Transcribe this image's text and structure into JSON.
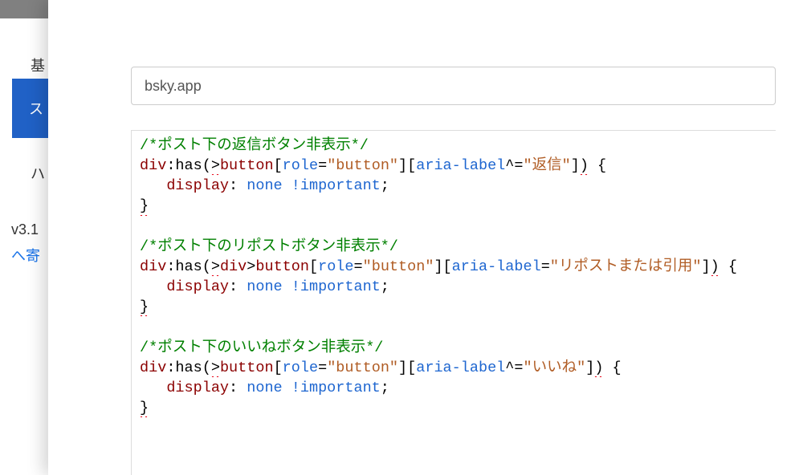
{
  "bg": {
    "heading_glimpse": "基",
    "blue_btn_glimpse": "ス",
    "note_glimpse": "ハ",
    "version": "v3.1",
    "donate": "へ寄"
  },
  "modal": {
    "url_value": "bsky.app"
  },
  "css": {
    "c1": "/*ポスト下の返信ボタン非表示*/",
    "c2": "/*ポスト下のリポストボタン非表示*/",
    "c3": "/*ポスト下のいいねボタン非表示*/",
    "sel1_a": "div",
    "sel1_b": ":has(",
    "sel1_c": "button",
    "sel1_d": "[",
    "sel1_e": "role",
    "sel1_f": "=",
    "sel1_g": "\"button\"",
    "sel1_h": "][",
    "sel1_i": "aria-label",
    "sel1_j": "^=",
    "sel1_k": "\"返信\"",
    "sel1_l": "]",
    "sel1_m": ") {",
    "sel1_gt": ">",
    "decl_prop": "display",
    "decl_colon": ": ",
    "decl_val": "none !important",
    "decl_semi": ";",
    "brace_close": "}",
    "sel2_a": "div",
    "sel2_b": ":has(",
    "sel2_c": "div",
    "sel2_d": ">",
    "sel2_e": "button",
    "sel2_f": "[",
    "sel2_g": "role",
    "sel2_h": "=",
    "sel2_i": "\"button\"",
    "sel2_j": "][",
    "sel2_k": "aria-label",
    "sel2_l": "=",
    "sel2_m": "\"リポストまたは引用\"",
    "sel2_n": "]",
    "sel2_o": ") {",
    "sel2_gt": ">",
    "sel3_a": "div",
    "sel3_b": ":has(",
    "sel3_c": "button",
    "sel3_d": "[",
    "sel3_e": "role",
    "sel3_f": "=",
    "sel3_g": "\"button\"",
    "sel3_h": "][",
    "sel3_i": "aria-label",
    "sel3_j": "^=",
    "sel3_k": "\"いいね\"",
    "sel3_l": "]",
    "sel3_m": ") {",
    "sel3_gt": ">"
  }
}
